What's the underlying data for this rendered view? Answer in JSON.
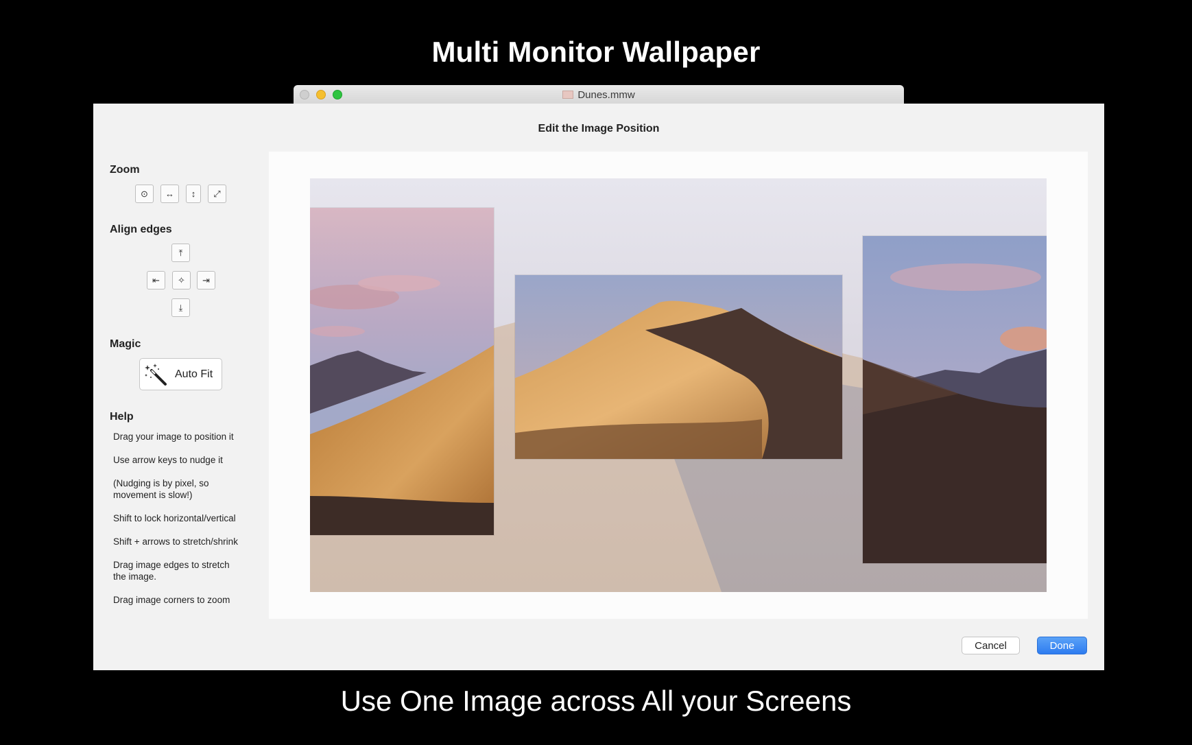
{
  "promo": {
    "headline": "Multi Monitor Wallpaper",
    "tagline": "Use One Image across All your Screens"
  },
  "window": {
    "document_title": "Dunes.mmw",
    "traffic_lights": [
      "close",
      "minimize",
      "zoom"
    ]
  },
  "sheet": {
    "title": "Edit the Image Position",
    "zoom": {
      "label": "Zoom",
      "tools": [
        {
          "name": "zoom-actual-size-icon",
          "glyph": "⊙"
        },
        {
          "name": "zoom-fit-width-icon",
          "glyph": "↔"
        },
        {
          "name": "zoom-fit-height-icon",
          "glyph": "↕"
        },
        {
          "name": "zoom-fill-icon",
          "glyph": "⤢"
        }
      ]
    },
    "align": {
      "label": "Align edges",
      "tools": [
        {
          "name": "align-top-icon",
          "glyph": "⤒"
        },
        {
          "name": "align-left-icon",
          "glyph": "⇤"
        },
        {
          "name": "align-center-icon",
          "glyph": "✧"
        },
        {
          "name": "align-right-icon",
          "glyph": "⇥"
        },
        {
          "name": "align-bottom-icon",
          "glyph": "⤓"
        }
      ]
    },
    "magic": {
      "label": "Magic",
      "auto_fit_label": "Auto Fit",
      "icon": "magic-wand-icon"
    },
    "help": {
      "label": "Help",
      "items": [
        "Drag your image to position it",
        "Use arrow keys to nudge it",
        "(Nudging is by pixel, so movement is slow!)",
        "Shift to lock horizontal/vertical",
        "Shift + arrows to stretch/shrink",
        "Drag image edges to stretch the image.",
        "Drag image corners to zoom"
      ]
    },
    "buttons": {
      "cancel": "Cancel",
      "done": "Done"
    },
    "accent_color": "#2e7cf0"
  }
}
